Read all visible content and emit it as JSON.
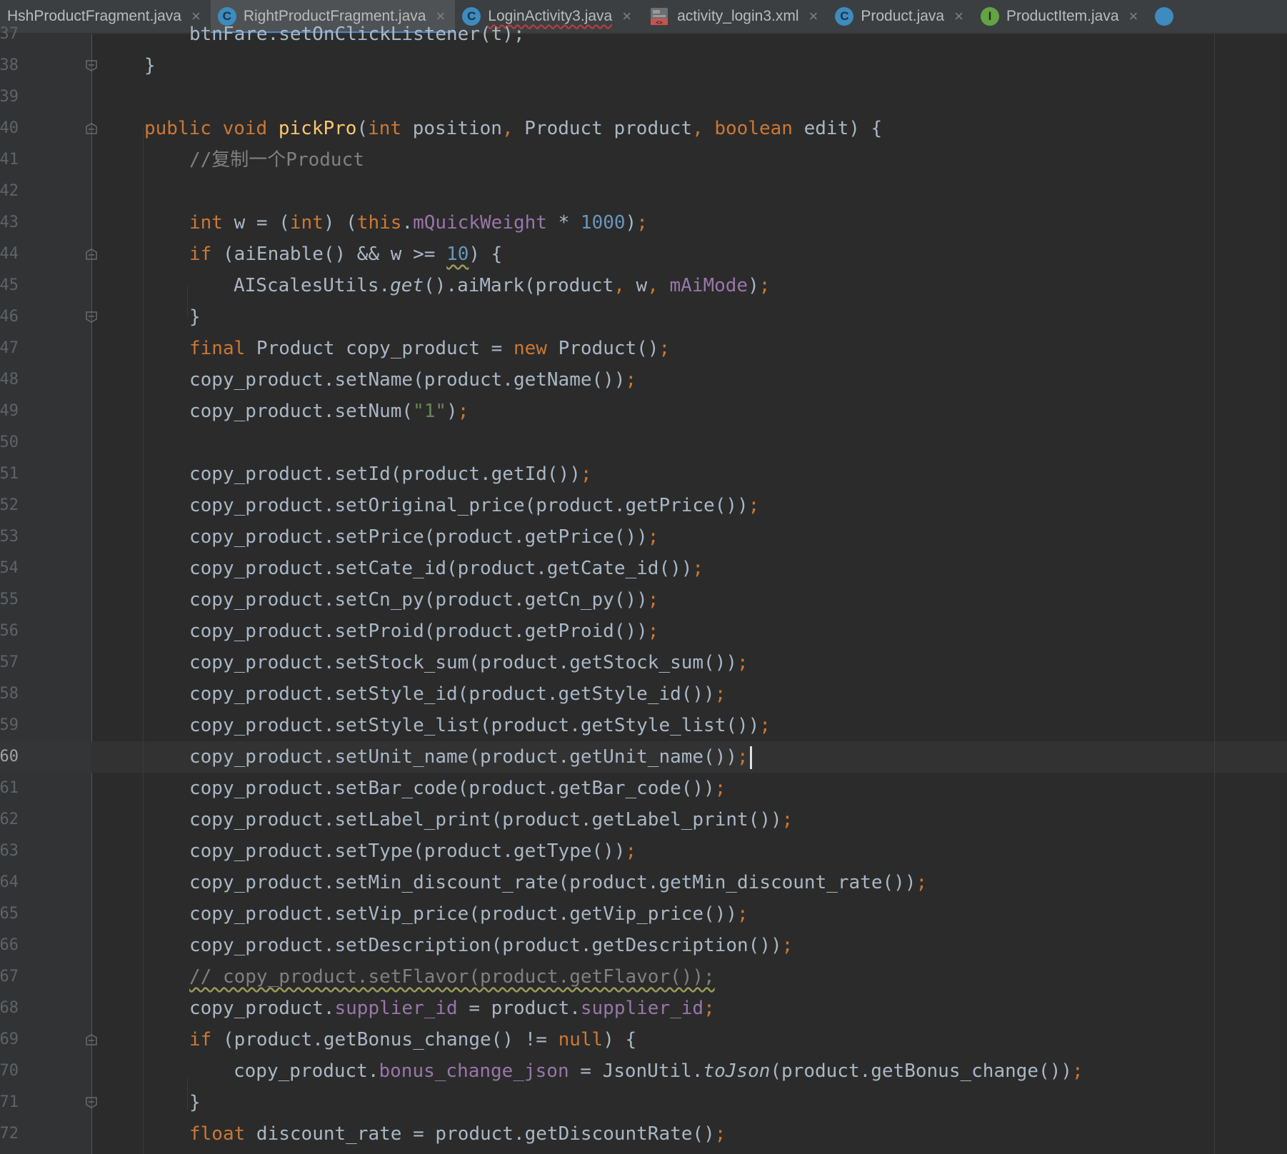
{
  "tabs": [
    {
      "label": "HshProductFragment.java",
      "icon": "none",
      "active": false,
      "close": "×"
    },
    {
      "label": "RightProductFragment.java",
      "icon": "class-icon",
      "icon_letter": "C",
      "active": true,
      "close": "×"
    },
    {
      "label": "LoginActivity3.java",
      "icon": "class-icon",
      "icon_letter": "C",
      "active": false,
      "close": "×"
    },
    {
      "label": "activity_login3.xml",
      "icon": "xml-layout-icon",
      "active": false,
      "close": "×"
    },
    {
      "label": "Product.java",
      "icon": "class-icon",
      "icon_letter": "C",
      "active": false,
      "close": "×"
    },
    {
      "label": "ProductItem.java",
      "icon": "interface-icon",
      "icon_letter": "I",
      "active": false,
      "close": "×"
    }
  ],
  "colors": {
    "background": "#2b2b2b",
    "keyword": "#cc7832",
    "method_declaration": "#ffc66d",
    "number": "#6897bb",
    "string": "#6a8759",
    "field": "#9876aa",
    "comment": "#808080",
    "default_text": "#a9b7c6",
    "active_tab_accent": "#4a88c7"
  },
  "editor": {
    "current_line_number": "60",
    "line_numbers": [
      "37",
      "38",
      "39",
      "40",
      "41",
      "42",
      "43",
      "44",
      "45",
      "46",
      "47",
      "48",
      "49",
      "50",
      "51",
      "52",
      "53",
      "54",
      "55",
      "56",
      "57",
      "58",
      "59",
      "60",
      "61",
      "62",
      "63",
      "64",
      "65",
      "66",
      "67",
      "68",
      "69",
      "70",
      "71",
      "72"
    ],
    "lines": {
      "l37": "btnFare.setOnClickListener(t);",
      "l38": "}",
      "l40": {
        "t1": "public",
        "t2": "void",
        "t3": "pickPro",
        "t4": "(",
        "t5": "int",
        "t6": " position",
        "t7": ",",
        "t8": " Product product",
        "t9": ",",
        "t10": "boolean",
        "t11": " edit) {"
      },
      "l41": "//复制一个Product",
      "l43": {
        "t1": "int",
        "t2": " w = (",
        "t3": "int",
        "t4": ") (",
        "t5": "this",
        "t6": ".",
        "t7": "mQuickWeight",
        "t8": " * ",
        "t9": "1000",
        "t10": ")",
        "t11": ";"
      },
      "l44": {
        "t1": "if",
        "t2": " (aiEnable() && w >= ",
        "t3": "10",
        "t4": ") {"
      },
      "l45": {
        "t1": "AIScalesUtils.",
        "t2": "get",
        "t3": "().aiMark(product",
        "t4": ",",
        "t5": " w",
        "t6": ",",
        "t7": "mAiMode",
        "t8": ")",
        "t9": ";"
      },
      "l46": "}",
      "l47": {
        "t1": "final",
        "t2": " Product copy_product = ",
        "t3": "new",
        "t4": " Product()",
        "t5": ";"
      },
      "l48": {
        "t1": "copy_product.setName(product.getName())",
        "t2": ";"
      },
      "l49": {
        "t1": "copy_product.setNum(",
        "t2": "\"1\"",
        "t3": ")",
        "t4": ";"
      },
      "l51": {
        "t1": "copy_product.setId(product.getId())",
        "t2": ";"
      },
      "l52": {
        "t1": "copy_product.setOriginal_price(product.getPrice())",
        "t2": ";"
      },
      "l53": {
        "t1": "copy_product.setPrice(product.getPrice())",
        "t2": ";"
      },
      "l54": {
        "t1": "copy_product.setCate_id(product.getCate_id())",
        "t2": ";"
      },
      "l55": {
        "t1": "copy_product.setCn_py(product.getCn_py())",
        "t2": ";"
      },
      "l56": {
        "t1": "copy_product.setProid(product.getProid())",
        "t2": ";"
      },
      "l57": {
        "t1": "copy_product.setStock_sum(product.getStock_sum())",
        "t2": ";"
      },
      "l58": {
        "t1": "copy_product.setStyle_id(product.getStyle_id())",
        "t2": ";"
      },
      "l59": {
        "t1": "copy_product.setStyle_list(product.getStyle_list())",
        "t2": ";"
      },
      "l60": {
        "t1": "copy_product.setUnit_name(product.getUnit_name())",
        "t2": ";"
      },
      "l61": {
        "t1": "copy_product.setBar_code(product.getBar_code())",
        "t2": ";"
      },
      "l62": {
        "t1": "copy_product.setLabel_print(product.getLabel_print())",
        "t2": ";"
      },
      "l63": {
        "t1": "copy_product.setType(product.getType())",
        "t2": ";"
      },
      "l64": {
        "t1": "copy_product.setMin_discount_rate(product.getMin_discount_rate())",
        "t2": ";"
      },
      "l65": {
        "t1": "copy_product.setVip_price(product.getVip_price())",
        "t2": ";"
      },
      "l66": {
        "t1": "copy_product.setDescription(product.getDescription())",
        "t2": ";"
      },
      "l67": "// copy_product.setFlavor(product.getFlavor());",
      "l68": {
        "t1": "copy_product.",
        "t2": "supplier_id",
        "t3": " = product.",
        "t4": "supplier_id",
        "t5": ";"
      },
      "l69": {
        "t1": "if",
        "t2": " (product.getBonus_change() != ",
        "t3": "null",
        "t4": ") {"
      },
      "l70": {
        "t1": "copy_product.",
        "t2": "bonus_change_json",
        "t3": " = JsonUtil.",
        "t4": "toJson",
        "t5": "(product.getBonus_change())",
        "t6": ";"
      },
      "l71": "}",
      "l72": {
        "t1": "float",
        "t2": " discount_rate = product.getDiscountRate()",
        "t3": ";"
      }
    }
  }
}
